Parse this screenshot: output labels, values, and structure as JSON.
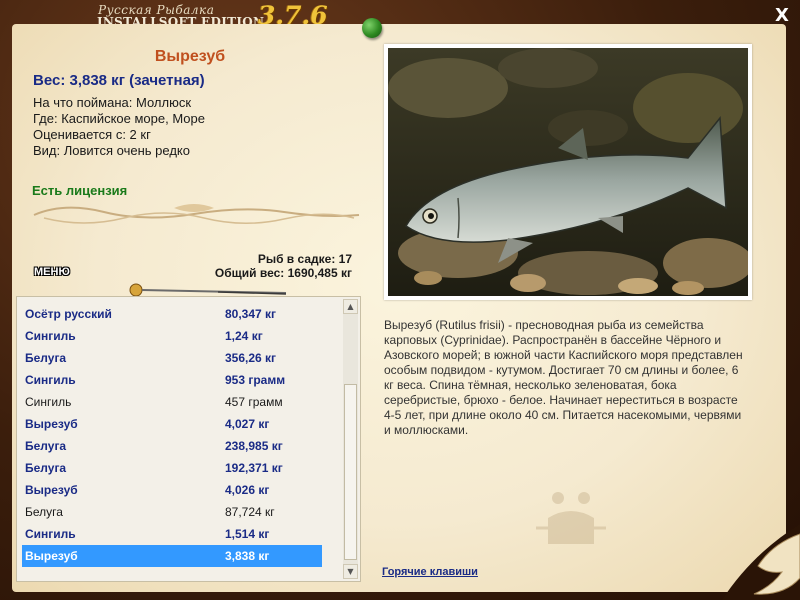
{
  "app": {
    "brand_line1": "Русская Рыбалка",
    "brand_line2": "INSTALLSOFT EDITION",
    "version": "3.7.6",
    "close_label": "X"
  },
  "fish": {
    "title": "Вырезуб",
    "weight_line": "Вес: 3,838 кг (зачетная)",
    "caught_on": "На что поймана: Моллюск",
    "where": "Где: Каспийское море, Море",
    "rated_from": "Оценивается с: 2 кг",
    "kind": "Вид: Ловится очень редко",
    "license": "Есть лицензия",
    "description": "Вырезуб (Rutilus frisii) - пресноводная рыба из семейства карповых (Cyprinidae). Распространён в бассейне Чёрного и Азовского морей; в южной части Каспийского моря представлен особым подвидом - кутумом. Достигает 70 см длины и более, 6 кг веса. Спина тёмная, несколько зеленоватая, бока серебристые, брюхо - белое. Начинает нереститься в возрасте 4-5 лет, при длине около 40 см. Питается насекомыми, червями и моллюсками."
  },
  "stats": {
    "in_cage": "Рыб в садке: 17",
    "total_weight": "Общий вес: 1690,485 кг"
  },
  "menu_label": "МЕНЮ",
  "catch_list": [
    {
      "name": "Осётр русский",
      "weight": "80,347 кг",
      "style": "bold"
    },
    {
      "name": "Сингиль",
      "weight": "1,24 кг",
      "style": "bold"
    },
    {
      "name": "Белуга",
      "weight": "356,26 кг",
      "style": "bold"
    },
    {
      "name": "Сингиль",
      "weight": "953 грамм",
      "style": "bold"
    },
    {
      "name": "Сингиль",
      "weight": "457 грамм",
      "style": "plain"
    },
    {
      "name": "Вырезуб",
      "weight": "4,027 кг",
      "style": "bold"
    },
    {
      "name": "Белуга",
      "weight": "238,985 кг",
      "style": "bold"
    },
    {
      "name": "Белуга",
      "weight": "192,371 кг",
      "style": "bold"
    },
    {
      "name": "Вырезуб",
      "weight": "4,026 кг",
      "style": "bold"
    },
    {
      "name": "Белуга",
      "weight": "87,724 кг",
      "style": "plain"
    },
    {
      "name": "Сингиль",
      "weight": "1,514 кг",
      "style": "bold"
    },
    {
      "name": "Вырезуб",
      "weight": "3,838 кг",
      "style": "selected"
    }
  ],
  "hotkeys_label": "Горячие клавиши",
  "colors": {
    "title_orange": "#c0501e",
    "list_blue": "#1a2b86",
    "license_green": "#1a7a1a",
    "selection": "#3399ff",
    "version_gold": "#f0c33a"
  }
}
